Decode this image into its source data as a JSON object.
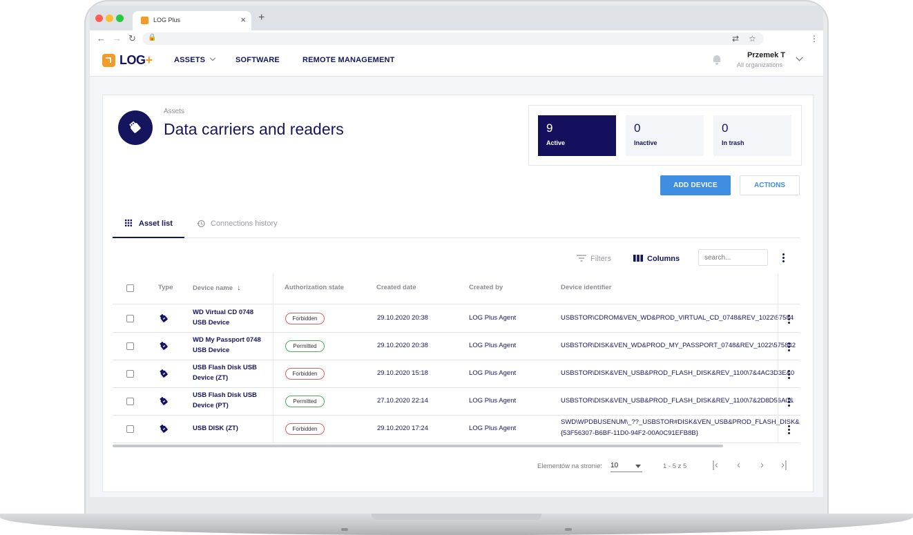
{
  "browser": {
    "tab_title": "LOG Plus",
    "new_tab": "+",
    "close": "×"
  },
  "app": {
    "logo_text": "LOG",
    "logo_plus": "+",
    "nav": [
      "ASSETS",
      "SOFTWARE",
      "REMOTE MANAGEMENT"
    ],
    "user_name": "Przemek T",
    "user_org": "All organizations"
  },
  "page": {
    "breadcrumb": "Assets",
    "title": "Data carriers and readers",
    "stats": [
      {
        "value": "9",
        "label": "Active"
      },
      {
        "value": "0",
        "label": "Inactive"
      },
      {
        "value": "0",
        "label": "In trash"
      }
    ],
    "add_label": "ADD DEVICE",
    "actions_label": "ACTIONS",
    "tabs": [
      "Asset list",
      "Connections history"
    ],
    "filters_label": "Filters",
    "columns_label": "Columns",
    "search_placeholder": "search..."
  },
  "table": {
    "headers": [
      "Type",
      "Device name",
      "Authorization state",
      "Created date",
      "Created by",
      "Device identifier"
    ],
    "rows": [
      {
        "name": "WD Virtual CD 0748 USB Device",
        "state": "Forbidden",
        "date": "29.10.2020 20:38",
        "by": "LOG Plus Agent",
        "id1": "USBSTOR\\CDROM&VEN_WD&PROD_VIRTUAL_CD_0748&REV_1022\\57584",
        "id2": ""
      },
      {
        "name": "WD My Passport 0748 USB Device",
        "state": "Permitted",
        "date": "29.10.2020 20:38",
        "by": "LOG Plus Agent",
        "id1": "USBSTOR\\DISK&VEN_WD&PROD_MY_PASSPORT_0748&REV_1022\\575842",
        "id2": ""
      },
      {
        "name": "USB Flash Disk USB Device (ZT)",
        "state": "Forbidden",
        "date": "29.10.2020 15:18",
        "by": "LOG Plus Agent",
        "id1": "USBSTOR\\DISK&VEN_USB&PROD_FLASH_DISK&REV_1100\\7&4AC3D3E&0",
        "id2": ""
      },
      {
        "name": "USB Flash Disk USB Device (PT)",
        "state": "Permitted",
        "date": "27.10.2020 22:14",
        "by": "LOG Plus Agent",
        "id1": "USBSTOR\\DISK&VEN_USB&PROD_FLASH_DISK&REV_1100\\7&2D8D56A0&",
        "id2": ""
      },
      {
        "name": "USB DISK (ZT)",
        "state": "Forbidden",
        "date": "29.10.2020 17:24",
        "by": "LOG Plus Agent",
        "id1": "SWD\\WPDBUSENUM\\_??_USBSTOR#DISK&VEN_USB&PROD_FLASH_DISK&",
        "id2": "{53F56307-B6BF-11D0-94F2-00A0C91EFB8B}"
      }
    ]
  },
  "pager": {
    "label": "Elementów na stronie:",
    "size": "10",
    "range": "1 - 5 z 5"
  }
}
